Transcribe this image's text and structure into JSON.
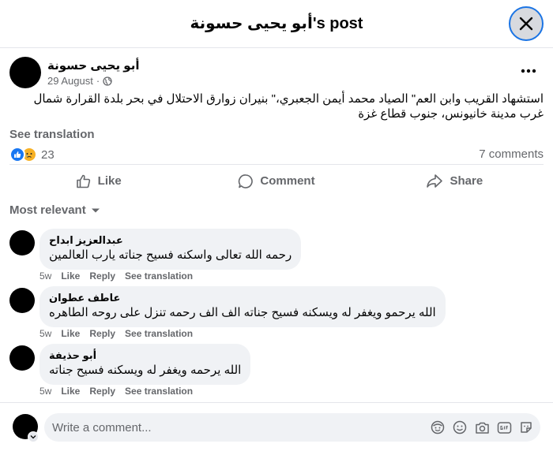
{
  "header": {
    "title": "أبو يحيى حسونة's post",
    "close_icon": "close-icon"
  },
  "post": {
    "author": "أبو يحيى حسونة",
    "date": "29 August",
    "separator": "·",
    "privacy_icon": "globe-icon",
    "text": "استشهاد القريب وابن العم\" الصياد محمد أيمن الجعبري،\" بنيران زوارق الاحتلال في بحر بلدة القرارة شمال غرب مدينة خانيونس، جنوب قطاع غزة",
    "see_translation": "See translation",
    "reaction_count": "23",
    "reaction_icons": [
      "like-reaction-icon",
      "sad-reaction-icon"
    ],
    "comments_count": "7 comments"
  },
  "actions": {
    "like": "Like",
    "comment": "Comment",
    "share": "Share"
  },
  "sort": {
    "label": "Most relevant"
  },
  "comments": [
    {
      "name": "عبدالعزيز ابداح",
      "text": "رحمه الله تعالى واسكنه فسيح جناته يارب العالمين",
      "time": "5w",
      "like": "Like",
      "reply": "Reply",
      "translate": "See translation"
    },
    {
      "name": "عاطف عطوان",
      "text": "الله يرحمو ويغفر له ويسكنه فسيح جناته الف الف رحمه تنزل على روحه الطاهره",
      "time": "5w",
      "like": "Like",
      "reply": "Reply",
      "translate": "See translation"
    },
    {
      "name": "أبو حذيفة",
      "text": "الله يرحمه ويغفر له ويسكنه فسيح جناته",
      "time": "5w",
      "like": "Like",
      "reply": "Reply",
      "translate": "See translation"
    }
  ],
  "composer": {
    "placeholder": "Write a comment...",
    "icons": [
      "avatar-sticker-icon",
      "emoji-icon",
      "camera-icon",
      "gif-icon",
      "sticker-icon"
    ]
  },
  "colors": {
    "accent": "#1877f2",
    "secondary_text": "#65676b",
    "bubble": "#f0f2f5",
    "sad": "#f7b125"
  }
}
